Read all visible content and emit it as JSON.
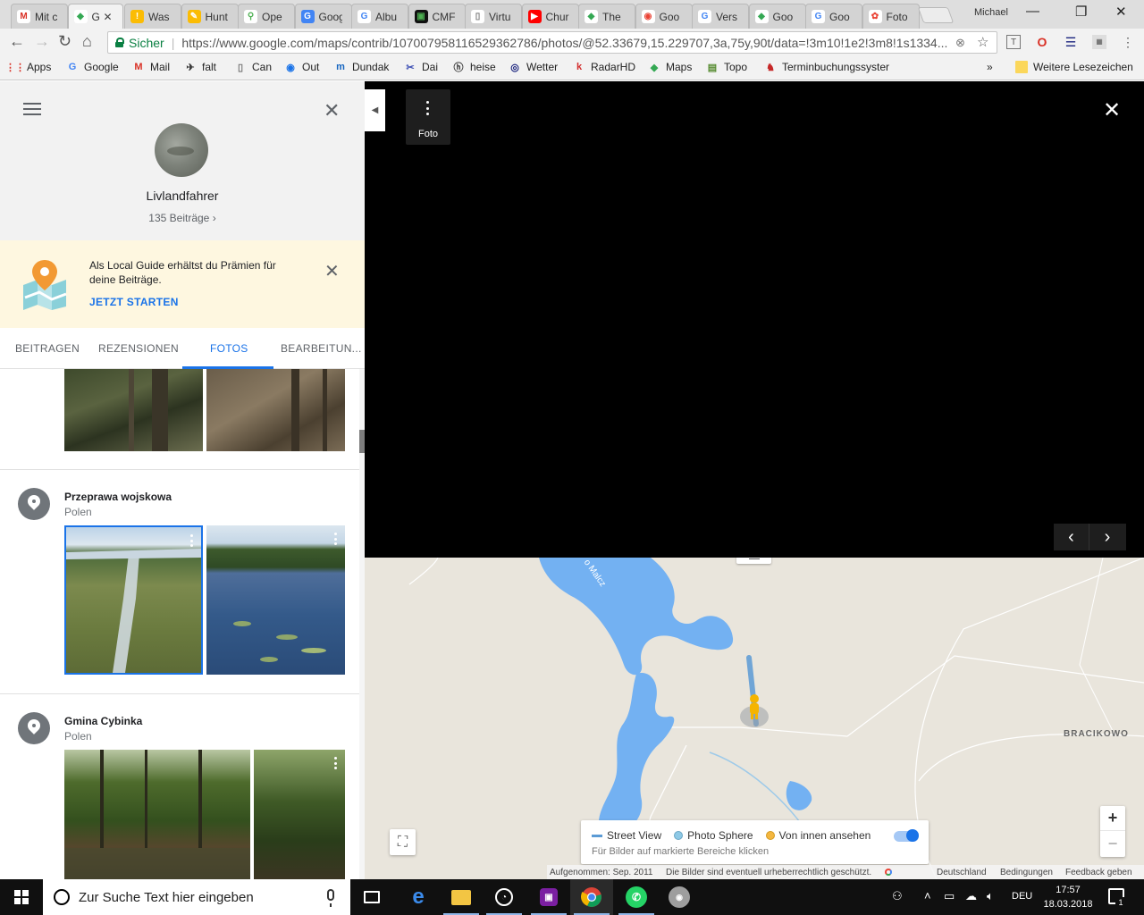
{
  "browser": {
    "tabs": [
      {
        "label": "Mit c",
        "color": "#ffffff",
        "glyph": "M",
        "glyph_color": "#d93025"
      },
      {
        "label": "G",
        "color": "#ffffff",
        "glyph": "◆",
        "glyph_color": "#34a853",
        "active": true
      },
      {
        "label": "Was",
        "color": "#fbbc04",
        "glyph": "!",
        "glyph_color": "#ffffff"
      },
      {
        "label": "Hunt",
        "color": "#fbbc04",
        "glyph": "✎",
        "glyph_color": "#ffffff"
      },
      {
        "label": "Ope",
        "color": "#ffffff",
        "glyph": "⚲",
        "glyph_color": "#4caf50"
      },
      {
        "label": "Goog",
        "color": "#4285f4",
        "glyph": "G",
        "glyph_color": "#ffffff"
      },
      {
        "label": "Albu",
        "color": "#ffffff",
        "glyph": "G",
        "glyph_color": "#4285f4"
      },
      {
        "label": "CMF",
        "color": "#111111",
        "glyph": "▣",
        "glyph_color": "#4caf50"
      },
      {
        "label": "Virtu",
        "color": "#ffffff",
        "glyph": "▯",
        "glyph_color": "#777777"
      },
      {
        "label": "Chur",
        "color": "#ff0000",
        "glyph": "▶",
        "glyph_color": "#ffffff"
      },
      {
        "label": "The",
        "color": "#ffffff",
        "glyph": "◆",
        "glyph_color": "#34a853"
      },
      {
        "label": "Goo",
        "color": "#ffffff",
        "glyph": "◉",
        "glyph_color": "#ea4335"
      },
      {
        "label": "Vers",
        "color": "#ffffff",
        "glyph": "G",
        "glyph_color": "#4285f4"
      },
      {
        "label": "Goo",
        "color": "#ffffff",
        "glyph": "◆",
        "glyph_color": "#34a853"
      },
      {
        "label": "Goo",
        "color": "#ffffff",
        "glyph": "G",
        "glyph_color": "#4285f4"
      },
      {
        "label": "Foto",
        "color": "#ffffff",
        "glyph": "✿",
        "glyph_color": "#ea4335"
      }
    ],
    "profile": "Michael",
    "secure_label": "Sicher",
    "url": "https://www.google.com/maps/contrib/107007958116529362786/photos/@52.33679,15.229707,3a,75y,90t/data=!3m10!1e2!3m8!1s1334...",
    "bookmarks": [
      {
        "label": "Apps",
        "glyph": "⋮⋮",
        "color": "#d93025"
      },
      {
        "label": "Google",
        "glyph": "G",
        "color": "#4285f4"
      },
      {
        "label": "Mail",
        "glyph": "M",
        "color": "#d93025"
      },
      {
        "label": "falt",
        "glyph": "✈",
        "color": "#333333"
      },
      {
        "label": "Can",
        "glyph": "▯",
        "color": "#777777"
      },
      {
        "label": "Out",
        "glyph": "◉",
        "color": "#1a73e8"
      },
      {
        "label": "Dundak",
        "glyph": "m",
        "color": "#1565c0"
      },
      {
        "label": "Dai",
        "glyph": "✂",
        "color": "#3f51b5"
      },
      {
        "label": "heise",
        "glyph": "ⓗ",
        "color": "#333333"
      },
      {
        "label": "Wetter",
        "glyph": "◎",
        "color": "#1a237e"
      },
      {
        "label": "RadarHD",
        "glyph": "k",
        "color": "#d32f2f"
      },
      {
        "label": "Maps",
        "glyph": "◆",
        "color": "#34a853"
      },
      {
        "label": "Topo",
        "glyph": "▤",
        "color": "#558b2f"
      },
      {
        "label": "Terminbuchungssyster",
        "glyph": "♞",
        "color": "#c62828"
      }
    ],
    "bookmarks_more": "»",
    "other_bookmarks": "Weitere Lesezeichen"
  },
  "panel": {
    "user_name": "Livlandfahrer",
    "contributions": "135 Beiträge",
    "banner": {
      "text": "Als Local Guide erhältst du Prämien für deine Beiträge.",
      "cta": "JETZT STARTEN"
    },
    "tabs": [
      {
        "label": "BEITRAGEN"
      },
      {
        "label": "REZENSIONEN"
      },
      {
        "label": "FOTOS",
        "active": true
      },
      {
        "label": "BEARBEITUN..."
      }
    ],
    "places": [
      {
        "title": "Przeprawa wojskowa",
        "subtitle": "Polen"
      },
      {
        "title": "Gmina Cybinka",
        "subtitle": "Polen"
      }
    ]
  },
  "viewer": {
    "foto_label": "Foto"
  },
  "map": {
    "place_label": "BRACIKOWO",
    "lake_label": "o Malcz",
    "legend": {
      "street_view": "Street View",
      "photo_sphere": "Photo Sphere",
      "inside": "Von innen ansehen",
      "hint": "Für Bilder auf markierte Bereiche klicken"
    },
    "colors": {
      "water": "#73b1f2",
      "land": "#e9e5dc",
      "street_view": "#5b9bd5",
      "photo_sphere": "#8ec9e6",
      "inside": "#f4b740"
    },
    "attribution": {
      "date": "Aufgenommen: Sep. 2011",
      "copyright": "Die Bilder sind eventuell urheberrechtlich geschützt.",
      "country": "Deutschland",
      "terms": "Bedingungen",
      "feedback": "Feedback geben"
    }
  },
  "taskbar": {
    "search_placeholder": "Zur Suche Text hier eingeben",
    "language": "DEU",
    "time": "17:57",
    "date": "18.03.2018",
    "notifications": "1"
  }
}
